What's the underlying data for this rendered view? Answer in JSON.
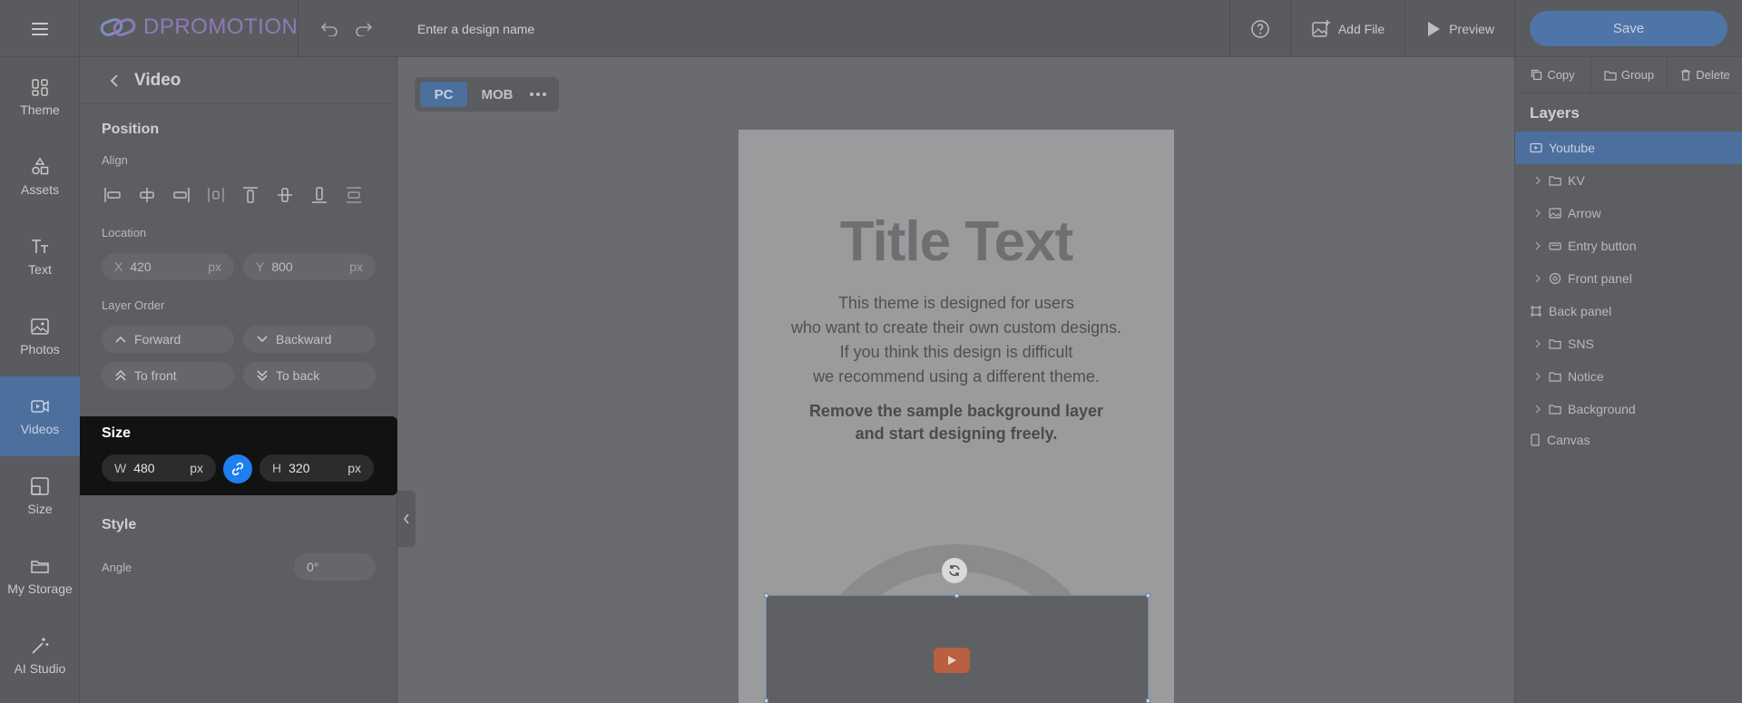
{
  "topbar": {
    "logo_text": "DPROMOTION",
    "design_name_placeholder": "Enter a design name",
    "add_file": "Add File",
    "preview": "Preview",
    "save": "Save"
  },
  "rail": {
    "items": [
      {
        "label": "Theme",
        "icon": "theme-icon"
      },
      {
        "label": "Assets",
        "icon": "assets-icon"
      },
      {
        "label": "Text",
        "icon": "text-icon"
      },
      {
        "label": "Photos",
        "icon": "photos-icon"
      },
      {
        "label": "Videos",
        "icon": "videos-icon",
        "active": true
      },
      {
        "label": "Size",
        "icon": "size-icon"
      },
      {
        "label": "My Storage",
        "icon": "folder-icon"
      },
      {
        "label": "AI Studio",
        "icon": "magic-wand-icon"
      }
    ]
  },
  "panel": {
    "title": "Video",
    "position_title": "Position",
    "align_label": "Align",
    "location_label": "Location",
    "x_key": "X",
    "x_value": "420",
    "x_unit": "px",
    "y_key": "Y",
    "y_value": "800",
    "y_unit": "px",
    "layer_order_label": "Layer Order",
    "forward": "Forward",
    "backward": "Backward",
    "to_front": "To front",
    "to_back": "To back",
    "size_title": "Size",
    "w_key": "W",
    "w_value": "480",
    "w_unit": "px",
    "h_key": "H",
    "h_value": "320",
    "h_unit": "px",
    "style_title": "Style",
    "angle_label": "Angle",
    "angle_value": "0°"
  },
  "canvas": {
    "pc": "PC",
    "mob": "MOB",
    "title_text": "Title Text",
    "body_lines": [
      "This theme is designed for users",
      "who want to create their own custom designs.",
      "If you think this design is difficult",
      "we recommend using a different theme."
    ],
    "strong_lines": [
      "Remove the sample background layer",
      "and start designing freely."
    ]
  },
  "right": {
    "copy": "Copy",
    "group": "Group",
    "delete": "Delete",
    "layers_title": "Layers",
    "layers": [
      {
        "label": "Youtube",
        "icon": "video-icon",
        "active": true,
        "chevron": false,
        "indent": 0
      },
      {
        "label": "KV",
        "icon": "folder-icon",
        "chevron": true,
        "indent": 1
      },
      {
        "label": "Arrow",
        "icon": "image-icon",
        "chevron": true,
        "indent": 1
      },
      {
        "label": "Entry button",
        "icon": "button-icon",
        "chevron": true,
        "indent": 1
      },
      {
        "label": "Front panel",
        "icon": "panel-icon",
        "chevron": true,
        "indent": 1
      },
      {
        "label": "Back panel",
        "icon": "frame-icon",
        "chevron": false,
        "indent": 0
      },
      {
        "label": "SNS",
        "icon": "folder-icon",
        "chevron": true,
        "indent": 1
      },
      {
        "label": "Notice",
        "icon": "folder-icon",
        "chevron": true,
        "indent": 1
      },
      {
        "label": "Background",
        "icon": "folder-icon",
        "chevron": true,
        "indent": 1
      },
      {
        "label": "Canvas",
        "icon": "canvas-icon",
        "chevron": false,
        "indent": 0
      }
    ]
  },
  "colors": {
    "accent": "#4d6f9e",
    "link_active": "#1f7ef0",
    "youtube": "#b8603f"
  }
}
